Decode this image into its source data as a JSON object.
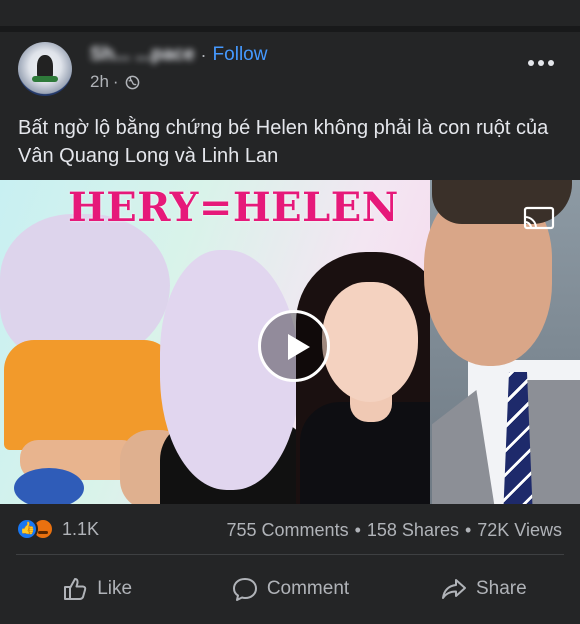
{
  "post": {
    "page_name": "Sh... ...pace",
    "follow_label": "Follow",
    "time": "2h",
    "caption": "Bất ngờ lộ bằng chứng bé Helen không phải là con ruột của Vân Quang Long và Linh Lan",
    "media": {
      "banner_text": "HERY=HELEN",
      "banner_color": "#e6197a"
    },
    "stats": {
      "reaction_count": "1.1K",
      "comments": "755 Comments",
      "shares": "158 Shares",
      "views": "72K Views",
      "separator": "•"
    },
    "actions": {
      "like": "Like",
      "comment": "Comment",
      "share": "Share"
    }
  },
  "colors": {
    "background": "#242526",
    "accent": "#4599ff",
    "text": "#e4e6eb",
    "secondary_text": "#b0b3b8"
  }
}
